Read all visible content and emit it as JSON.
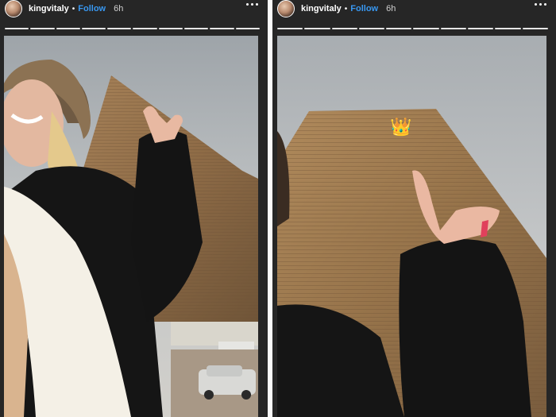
{
  "stories": [
    {
      "username": "kingvitaly",
      "follow_label": "Follow",
      "separator": "•",
      "time": "6h",
      "segments": 10
    },
    {
      "username": "kingvitaly",
      "follow_label": "Follow",
      "separator": "•",
      "time": "6h",
      "segments": 10
    }
  ],
  "emoji": {
    "crown": "👑"
  },
  "colors": {
    "follow": "#3897f0",
    "panel_bg": "#262626"
  }
}
